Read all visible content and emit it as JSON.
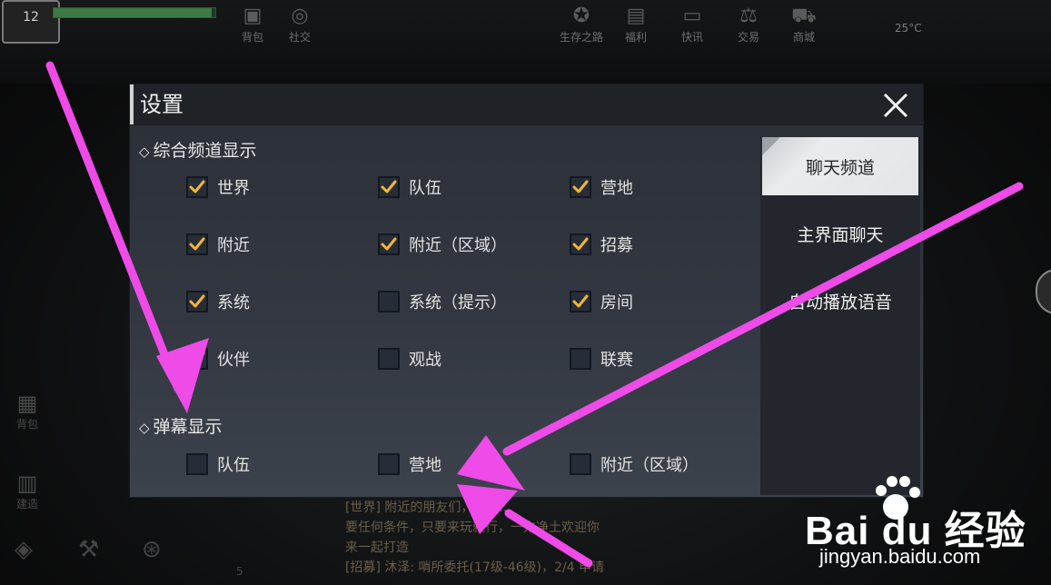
{
  "hud": {
    "level": "12",
    "top_icons": [
      {
        "label": "背包",
        "icon": "backpack-icon"
      },
      {
        "label": "社交",
        "icon": "social-icon"
      },
      {
        "label": "生存之路",
        "icon": "shield-star-icon"
      },
      {
        "label": "福利",
        "icon": "gift-icon"
      },
      {
        "label": "快讯",
        "icon": "news-icon"
      },
      {
        "label": "交易",
        "icon": "scale-icon"
      },
      {
        "label": "商城",
        "icon": "cart-icon"
      }
    ],
    "temperature": "25°C",
    "hp_percent": 0.98,
    "left_icons": [
      {
        "label": "背包",
        "icon": "bag-icon"
      },
      {
        "label": "建造",
        "icon": "build-icon"
      }
    ],
    "chat_lines": [
      "[世界] 附近的朋友们，一起...",
      "要任何条件，只要来玩就行，一方净土欢迎你",
      "来一起打造",
      "[招募] 沐泽: 哨所委托(17级-46级)，2/4 申请"
    ],
    "bottom_badge": "5"
  },
  "dialog": {
    "title": "设置",
    "section1_title": "综合频道显示",
    "section2_title": "弹幕显示",
    "general_options": [
      {
        "label": "世界",
        "checked": true
      },
      {
        "label": "队伍",
        "checked": true
      },
      {
        "label": "营地",
        "checked": true
      },
      {
        "label": "附近",
        "checked": true
      },
      {
        "label": "附近（区域）",
        "checked": true
      },
      {
        "label": "招募",
        "checked": true
      },
      {
        "label": "系统",
        "checked": true
      },
      {
        "label": "系统（提示）",
        "checked": false
      },
      {
        "label": "房间",
        "checked": true
      },
      {
        "label": "伙伴",
        "checked": true
      },
      {
        "label": "观战",
        "checked": false
      },
      {
        "label": "联赛",
        "checked": false
      }
    ],
    "danmaku_options": [
      {
        "label": "队伍",
        "checked": false
      },
      {
        "label": "营地",
        "checked": false
      },
      {
        "label": "附近（区域）",
        "checked": false
      }
    ],
    "tabs": [
      {
        "label": "聊天频道",
        "active": true
      },
      {
        "label": "主界面聊天",
        "active": false
      },
      {
        "label": "自动播放语音",
        "active": false
      }
    ]
  },
  "watermark": {
    "brand": "Bai du 经验",
    "url": "jingyan.baidu.com"
  },
  "colors": {
    "checkmark": "#f2b632",
    "arrow": "#ee4be8"
  }
}
